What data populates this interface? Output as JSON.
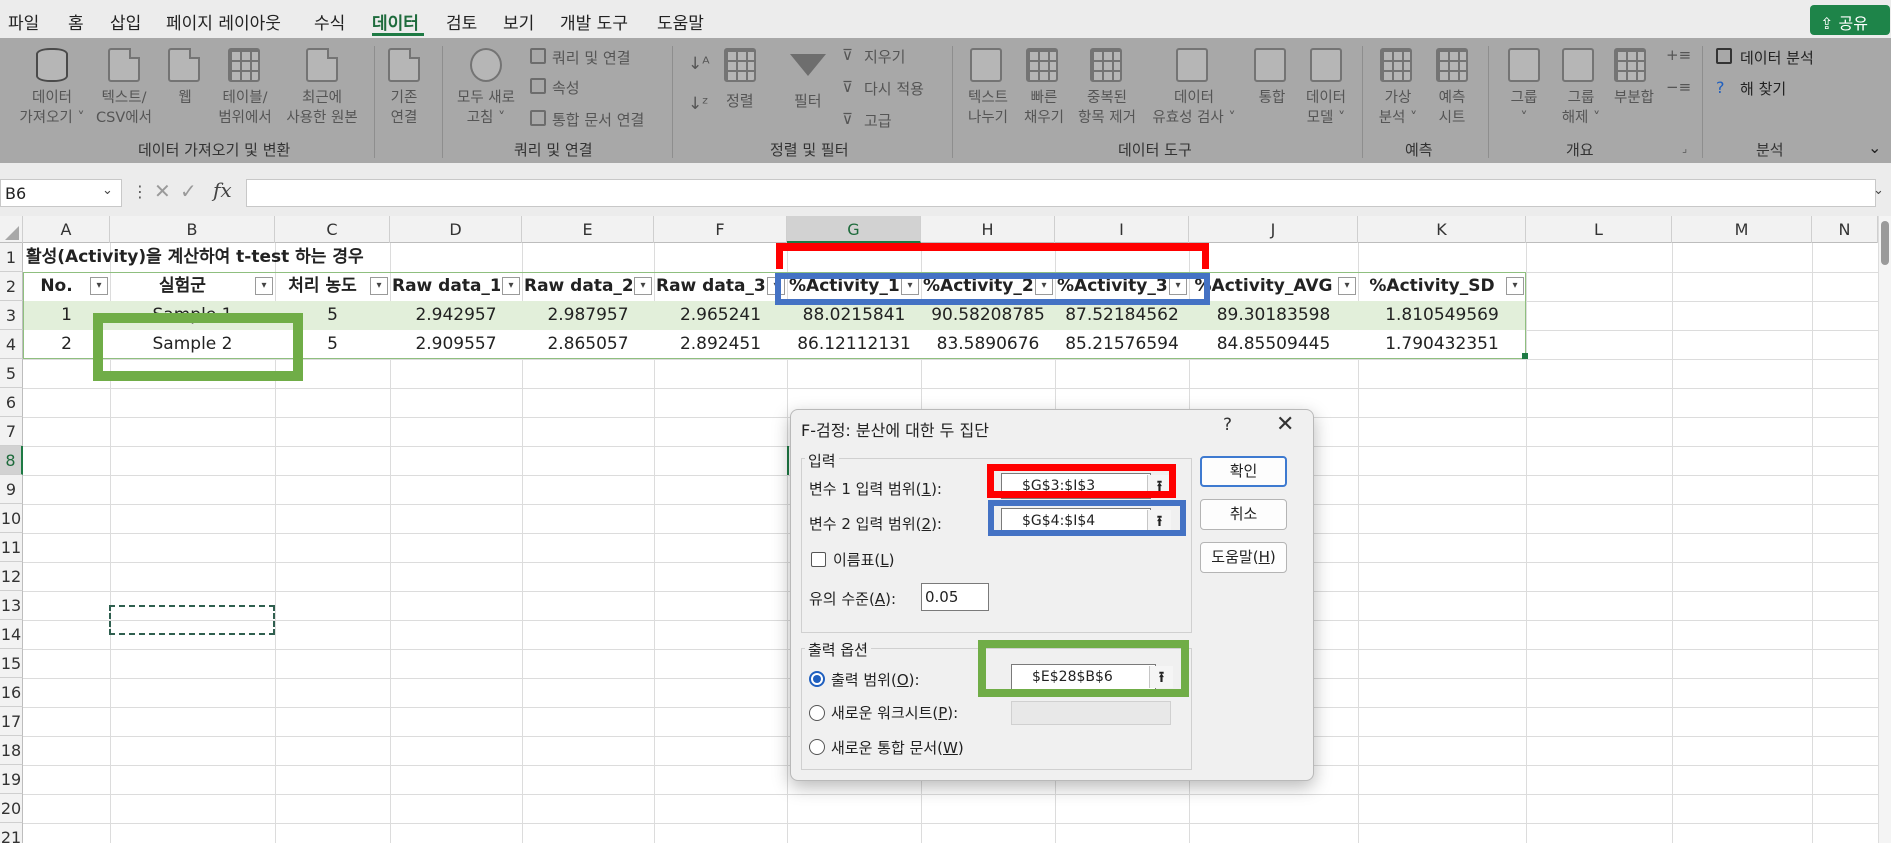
{
  "menu": {
    "items": [
      "파일",
      "홈",
      "삽입",
      "페이지 레이아웃",
      "수식",
      "데이터",
      "검토",
      "보기",
      "개발 도구",
      "도움말"
    ],
    "active": "데이터",
    "share_label": "공유"
  },
  "ribbon": {
    "get_data": {
      "line1": "데이터",
      "line2": "가져오기 ˅"
    },
    "text_csv": {
      "line1": "텍스트/",
      "line2": "CSV에서"
    },
    "web": {
      "line1": "웹"
    },
    "table_range": {
      "line1": "테이블/",
      "line2": "범위에서"
    },
    "recent_sources": {
      "line1": "최근에",
      "line2": "사용한 원본"
    },
    "existing_conn": {
      "line1": "기존",
      "line2": "연결"
    },
    "refresh_all": {
      "line1": "모두 새로",
      "line2": "고침 ˅"
    },
    "queries_connections": "쿼리 및 연결",
    "properties": "속성",
    "workbook_links": "통합 문서 연결",
    "sort": "정렬",
    "filter": "필터",
    "clear": "지우기",
    "reapply": "다시 적용",
    "advanced": "고급",
    "text_to_columns": {
      "line1": "텍스트",
      "line2": "나누기"
    },
    "flash_fill": {
      "line1": "빠른",
      "line2": "채우기"
    },
    "remove_duplicates": {
      "line1": "중복된",
      "line2": "항목 제거"
    },
    "data_validation": {
      "line1": "데이터",
      "line2": "유효성 검사 ˅"
    },
    "consolidate": {
      "line1": "통합"
    },
    "data_model": {
      "line1": "데이터",
      "line2": "모델 ˅"
    },
    "what_if": {
      "line1": "가상",
      "line2": "분석 ˅"
    },
    "forecast_sheet": {
      "line1": "예측",
      "line2": "시트"
    },
    "group": {
      "line1": "그룹",
      "line2": "˅"
    },
    "ungroup": {
      "line1": "그룹",
      "line2": "해제 ˅"
    },
    "subtotal": {
      "line1": "부분합"
    },
    "data_analysis": "데이터 분석",
    "solver": "해 찾기",
    "groups": {
      "get_transform": "데이터 가져오기 및 변환",
      "queries": "쿼리 및 연결",
      "sort_filter": "정렬 및 필터",
      "data_tools": "데이터 도구",
      "forecast": "예측",
      "outline": "개요",
      "analysis": "분석"
    }
  },
  "formula_bar": {
    "name_box": "B6",
    "formula": ""
  },
  "sheet": {
    "columns": [
      "A",
      "B",
      "C",
      "D",
      "E",
      "F",
      "G",
      "H",
      "I",
      "J",
      "K",
      "L",
      "M",
      "N"
    ],
    "selected_column": "G",
    "rows": [
      "1",
      "2",
      "3",
      "4",
      "5",
      "6",
      "7",
      "8",
      "9",
      "10",
      "11",
      "12",
      "13",
      "14",
      "15",
      "16",
      "17",
      "18",
      "19",
      "20",
      "21"
    ],
    "selected_row": "8",
    "title": "활성(Activity)을 계산하여 t-test 하는 경우",
    "headers": [
      "No.",
      "실험군",
      "처리 농도",
      "Raw data_1",
      "Raw data_2",
      "Raw data_3",
      "%Activity_1",
      "%Activity_2",
      "%Activity_3",
      "%Activity_AVG",
      "%Activity_SD"
    ],
    "data_rows": [
      [
        "1",
        "Sample 1",
        "5",
        "2.942957",
        "2.987957",
        "2.965241",
        "88.0215841",
        "90.58208785",
        "87.52184562",
        "89.30183598",
        "1.810549569"
      ],
      [
        "2",
        "Sample 2",
        "5",
        "2.909557",
        "2.865057",
        "2.892451",
        "86.12112131",
        "83.5890676",
        "85.21576594",
        "84.85509445",
        "1.790432351"
      ]
    ]
  },
  "dialog": {
    "title": "F-검정: 분산에 대한 두 집단",
    "help": "?",
    "close": "✕",
    "input_section": "입력",
    "var1_label": "변수 1 입력 범위(",
    "var1_key": "1",
    "var1_value": "$G$3:$I$3",
    "var2_label": "변수 2 입력 범위(",
    "var2_key": "2",
    "var2_value": "$G$4:$I$4",
    "labels_label": "이름표(",
    "labels_key": "L",
    "alpha_label": "유의 수준(",
    "alpha_key": "A",
    "alpha_value": "0.05",
    "output_section": "출력 옵션",
    "output_range_label": "출력 범위(",
    "output_range_key": "O",
    "output_range_value": "$E$28$B$6",
    "new_sheet_label": "새로운 워크시트(",
    "new_sheet_key": "P",
    "new_workbook_label": "새로운 통합 문서(",
    "new_workbook_key": "W",
    "ok": "확인",
    "cancel": "취소",
    "help_btn": "도움말(",
    "help_btn_key": "H",
    "close_paren": ")",
    "colon": "):"
  },
  "colors": {
    "accent_green": "#1e7a44",
    "annotation_red": "#ff0000",
    "annotation_blue": "#4472c4",
    "annotation_green": "#70ad47",
    "table_row_band": "#e2efda"
  }
}
